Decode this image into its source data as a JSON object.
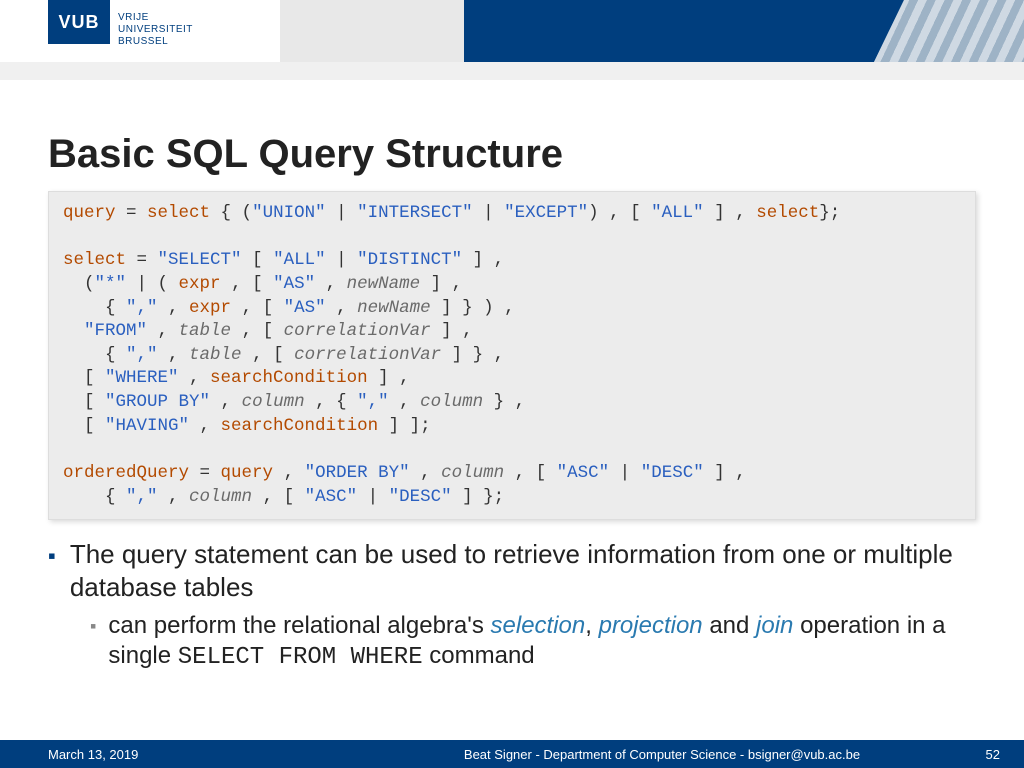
{
  "logo": {
    "abbr": "VUB",
    "line1": "VRIJE",
    "line2": "UNIVERSITEIT",
    "line3": "BRUSSEL"
  },
  "title": "Basic SQL Query Structure",
  "code": {
    "l1a": "query",
    "l1b": " = ",
    "l1c": "select",
    "l1d": " { (",
    "l1e": "\"UNION\"",
    "l1f": " | ",
    "l1g": "\"INTERSECT\"",
    "l1h": " | ",
    "l1i": "\"EXCEPT\"",
    "l1j": ") , [ ",
    "l1k": "\"ALL\"",
    "l1l": " ] , ",
    "l1m": "select",
    "l1n": "};",
    "l2a": "select",
    "l2b": " = ",
    "l2c": "\"SELECT\"",
    "l2d": " [ ",
    "l2e": "\"ALL\"",
    "l2f": " | ",
    "l2g": "\"DISTINCT\"",
    "l2h": " ] ,",
    "l3a": "  (",
    "l3b": "\"*\"",
    "l3c": " | ( ",
    "l3d": "expr",
    "l3e": " , [ ",
    "l3f": "\"AS\"",
    "l3g": " , ",
    "l3h": "newName",
    "l3i": " ] ,",
    "l4a": "    { ",
    "l4b": "\",\"",
    "l4c": " , ",
    "l4d": "expr",
    "l4e": " , [ ",
    "l4f": "\"AS\"",
    "l4g": " , ",
    "l4h": "newName",
    "l4i": " ] } ) ,",
    "l5a": "  ",
    "l5b": "\"FROM\"",
    "l5c": " , ",
    "l5d": "table",
    "l5e": " , [ ",
    "l5f": "correlationVar",
    "l5g": " ] ,",
    "l6a": "    { ",
    "l6b": "\",\"",
    "l6c": " , ",
    "l6d": "table",
    "l6e": " , [ ",
    "l6f": "correlationVar",
    "l6g": " ] } ,",
    "l7a": "  [ ",
    "l7b": "\"WHERE\"",
    "l7c": " , ",
    "l7d": "searchCondition",
    "l7e": " ] ,",
    "l8a": "  [ ",
    "l8b": "\"GROUP BY\"",
    "l8c": " , ",
    "l8d": "column",
    "l8e": " , { ",
    "l8f": "\",\"",
    "l8g": " , ",
    "l8h": "column",
    "l8i": " } ,",
    "l9a": "  [ ",
    "l9b": "\"HAVING\"",
    "l9c": " , ",
    "l9d": "searchCondition",
    "l9e": " ] ];",
    "l10a": "orderedQuery",
    "l10b": " = ",
    "l10c": "query",
    "l10d": " , ",
    "l10e": "\"ORDER BY\"",
    "l10f": " , ",
    "l10g": "column",
    "l10h": " , [ ",
    "l10i": "\"ASC\"",
    "l10j": " | ",
    "l10k": "\"DESC\"",
    "l10l": " ] ,",
    "l11a": "    { ",
    "l11b": "\",\"",
    "l11c": " , ",
    "l11d": "column",
    "l11e": " , [ ",
    "l11f": "\"ASC\"",
    "l11g": " | ",
    "l11h": "\"DESC\"",
    "l11i": " ] };"
  },
  "bullets": {
    "b1": "The query statement can be used to retrieve information from one or multiple database tables",
    "b2_pre": "can perform the relational algebra's ",
    "b2_sel": "selection",
    "b2_c1": ", ",
    "b2_proj": "projection",
    "b2_and": " and ",
    "b2_join": "join",
    "b2_post1": " operation in a single ",
    "b2_mono": "SELECT FROM WHERE",
    "b2_post2": " command"
  },
  "footer": {
    "date": "March 13, 2019",
    "center": "Beat Signer - Department of Computer Science - bsigner@vub.ac.be",
    "page": "52"
  }
}
